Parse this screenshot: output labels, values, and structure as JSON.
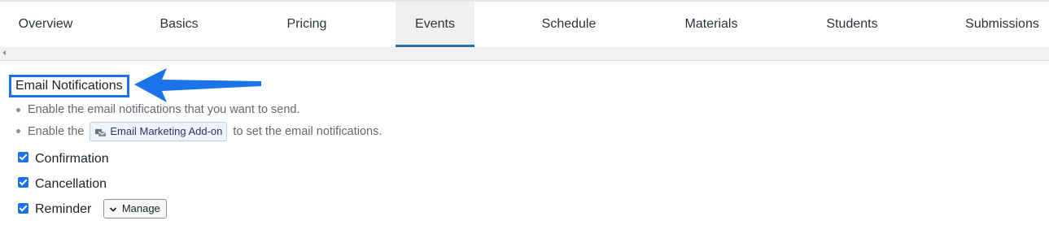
{
  "tabs": [
    {
      "label": "Overview",
      "active": false
    },
    {
      "label": "Basics",
      "active": false
    },
    {
      "label": "Pricing",
      "active": false
    },
    {
      "label": "Events",
      "active": true
    },
    {
      "label": "Schedule",
      "active": false
    },
    {
      "label": "Materials",
      "active": false
    },
    {
      "label": "Students",
      "active": false
    },
    {
      "label": "Submissions",
      "active": false
    }
  ],
  "section": {
    "title": "Email Notifications",
    "bullet1": "Enable the email notifications that you want to send.",
    "bullet2_before": "Enable the",
    "addon_label": "Email Marketing Add-on",
    "bullet2_after": "to set the email notifications."
  },
  "checkboxes": [
    {
      "label": "Confirmation",
      "checked": true
    },
    {
      "label": "Cancellation",
      "checked": true
    },
    {
      "label": "Reminder",
      "checked": true
    }
  ],
  "manage_label": "Manage",
  "colors": {
    "accent": "#1a73e8",
    "active_tab_underline": "#2271b1",
    "arrow": "#1a73e8"
  },
  "icons": {
    "addon": "email-marketing-icon",
    "manage": "chevron-down-icon",
    "scroll": "scroll-left-icon",
    "annotation": "arrow-annotation"
  }
}
